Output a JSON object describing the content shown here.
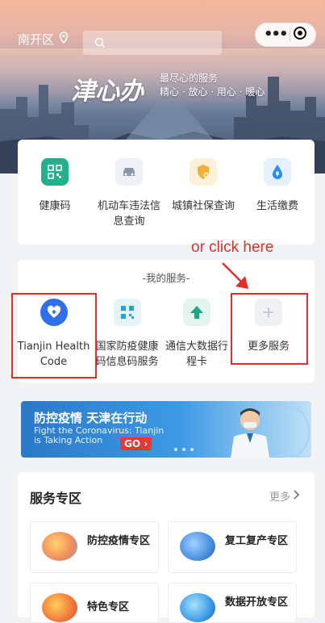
{
  "header": {
    "district": "南开区",
    "brand": "津心办",
    "slogan_line1": "最尽心的服务",
    "slogan_line2": "精心 · 放心 · 用心 · 暖心"
  },
  "quick_services": [
    {
      "label": "健康码",
      "icon": "qr-code-icon",
      "color": "#23b08b"
    },
    {
      "label": "机动车违法信息查询",
      "icon": "car-icon",
      "color": "#8996a8"
    },
    {
      "label": "城镇社保查询",
      "icon": "social-security-icon",
      "color": "#f0b238"
    },
    {
      "label": "生活缴费",
      "icon": "water-drop-icon",
      "color": "#2b8ff0"
    }
  ],
  "my_services": {
    "title": "-我的服务-",
    "items": [
      {
        "label": "Tianjin Health Code",
        "icon": "heart-shield-icon",
        "color": "#2f6fe8"
      },
      {
        "label": "国家防疫健康码信息码服务",
        "icon": "qr-code-icon",
        "color": "#2aa0d8"
      },
      {
        "label": "通信大数据行程卡",
        "icon": "location-arrow-icon",
        "color": "#1fa57f"
      },
      {
        "label": "更多服务",
        "icon": "plus-icon",
        "color": "#b9bec6"
      }
    ]
  },
  "annotation": "or click here",
  "banner": {
    "title": "防控疫情  天津在行动",
    "subtitle_line1": "Fight the Coronavirus: Tianjin",
    "subtitle_line2": "is Taking Action",
    "go_label": "GO ›"
  },
  "service_zone": {
    "title": "服务专区",
    "more_label": "更多",
    "tiles": [
      {
        "label": "防控疫情专区"
      },
      {
        "label": "复工复产专区"
      },
      {
        "label": "特色专区"
      },
      {
        "label": "数据开放专区"
      }
    ]
  }
}
